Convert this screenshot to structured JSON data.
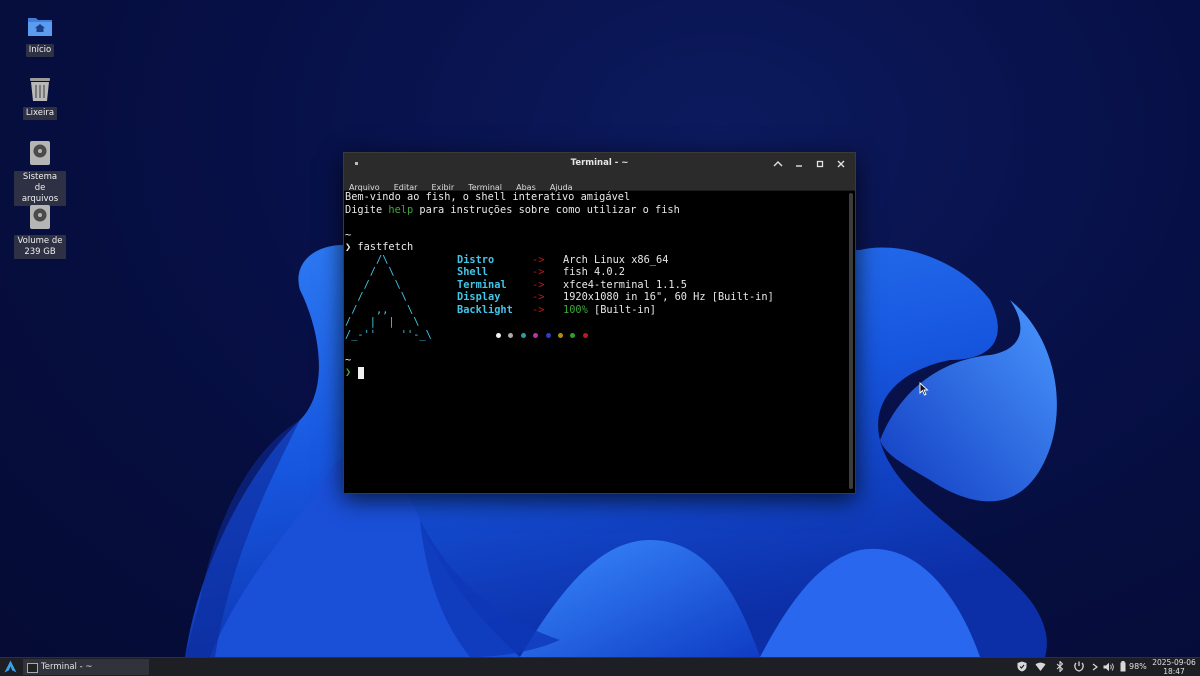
{
  "desktop": {
    "icons": [
      {
        "label": "Início",
        "icon": "home-folder-icon"
      },
      {
        "label": "Lixeira",
        "icon": "trash-icon"
      },
      {
        "label": "Sistema de arquivos",
        "icon": "drive-icon"
      },
      {
        "label": "Volume de 239 GB",
        "icon": "drive-icon"
      }
    ]
  },
  "window": {
    "title": "Terminal - ~",
    "menu": [
      "Arquivo",
      "Editar",
      "Exibir",
      "Terminal",
      "Abas",
      "Ajuda"
    ],
    "buttons": [
      "shade-icon",
      "minimize-icon",
      "maximize-icon",
      "close-icon"
    ]
  },
  "terminal": {
    "welcome_line": "Bem-vindo ao fish, o shell interativo amigável",
    "help_line_prefix": "Digite ",
    "help_word": "help",
    "help_line_suffix": " para instruções sobre como utilizar o fish",
    "tilde": "~",
    "prompt_symbol": "❯",
    "command": "fastfetch",
    "ascii_logo": [
      "     /\\",
      "    /  \\",
      "   /    \\",
      "  /      \\",
      " /   ,,   \\",
      "/   |  |   \\",
      "/_-''    ''-_\\"
    ],
    "info": [
      {
        "key": "Distro",
        "arrow": "->",
        "value": "Arch Linux x86_64"
      },
      {
        "key": "Shell",
        "arrow": "->",
        "value": "fish 4.0.2"
      },
      {
        "key": "Terminal",
        "arrow": "->",
        "value": "xfce4-terminal 1.1.5"
      },
      {
        "key": "Display",
        "arrow": "->",
        "value": "1920x1080 in 16\", 60 Hz [Built-in]"
      },
      {
        "key": "Backlight",
        "arrow": "->",
        "value_highlight": "100%",
        "value": " [Built-in]"
      }
    ],
    "palette": [
      "#f2f2f2",
      "#aaaaaa",
      "#2aa198",
      "#c030a8",
      "#2a3ec8",
      "#b08a20",
      "#2e9e2e",
      "#b81c1c"
    ]
  },
  "taskbar": {
    "start_icon": "arch-logo-icon",
    "task_label": "Terminal - ~",
    "tray_icons": [
      "shield-icon",
      "wifi-icon",
      "bluetooth-icon",
      "power-profile-icon",
      "chevron-right-icon",
      "volume-icon",
      "battery-icon"
    ],
    "battery": "98%",
    "date": "2025-09-06",
    "time": "18:47"
  },
  "colors": {
    "terminal_bg": "#000000",
    "cyan": "#43c6e8",
    "green": "#3ea53e",
    "arrow_red": "#b21e1e"
  }
}
